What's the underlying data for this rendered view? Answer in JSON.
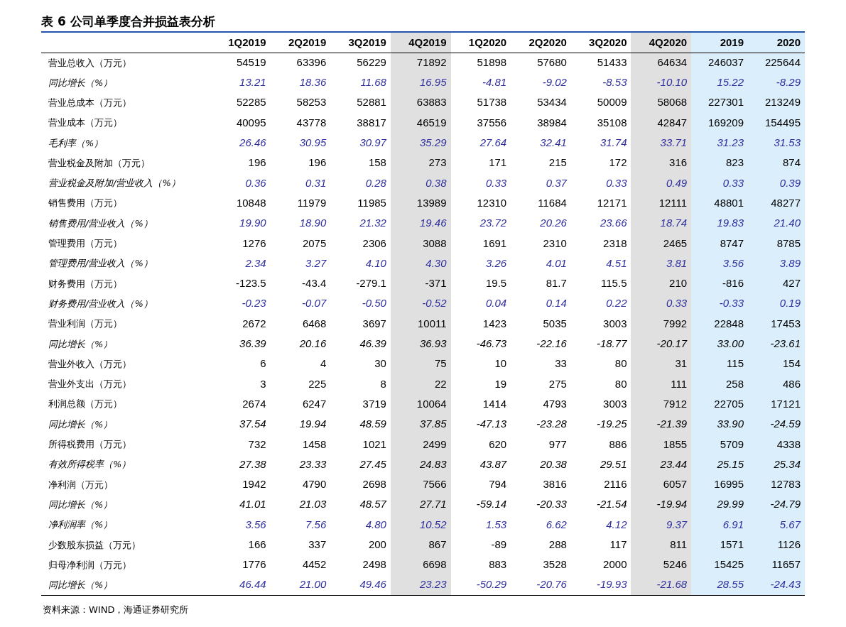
{
  "title": "表 6 公司单季度合并损益表分析",
  "columns": [
    {
      "label": "1Q2019"
    },
    {
      "label": "2Q2019"
    },
    {
      "label": "3Q2019"
    },
    {
      "label": "4Q2019",
      "color": "#e0e0e0"
    },
    {
      "label": "1Q2020"
    },
    {
      "label": "2Q2020"
    },
    {
      "label": "3Q2020"
    },
    {
      "label": "4Q2020",
      "color": "#e0e0e0"
    },
    {
      "label": "2019",
      "color": "#daeefb"
    },
    {
      "label": "2020",
      "color": "#daeefb"
    }
  ],
  "rows": [
    {
      "label": "营业总收入（万元）",
      "kind": "amount",
      "values": [
        "54519",
        "63396",
        "56229",
        "71892",
        "51898",
        "57680",
        "51433",
        "64634",
        "246037",
        "225644"
      ]
    },
    {
      "label": "同比增长（%）",
      "kind": "ratio",
      "values": [
        "13.21",
        "18.36",
        "11.68",
        "16.95",
        "-4.81",
        "-9.02",
        "-8.53",
        "-10.10",
        "15.22",
        "-8.29"
      ]
    },
    {
      "label": "营业总成本（万元）",
      "kind": "amount",
      "values": [
        "52285",
        "58253",
        "52881",
        "63883",
        "51738",
        "53434",
        "50009",
        "58068",
        "227301",
        "213249"
      ]
    },
    {
      "label": "营业成本（万元）",
      "kind": "amount",
      "values": [
        "40095",
        "43778",
        "38817",
        "46519",
        "37556",
        "38984",
        "35108",
        "42847",
        "169209",
        "154495"
      ]
    },
    {
      "label": "毛利率（%）",
      "kind": "ratio",
      "values": [
        "26.46",
        "30.95",
        "30.97",
        "35.29",
        "27.64",
        "32.41",
        "31.74",
        "33.71",
        "31.23",
        "31.53"
      ]
    },
    {
      "label": "营业税金及附加（万元）",
      "kind": "amount",
      "values": [
        "196",
        "196",
        "158",
        "273",
        "171",
        "215",
        "172",
        "316",
        "823",
        "874"
      ]
    },
    {
      "label": "营业税金及附加/营业收入（%）",
      "kind": "ratio",
      "values": [
        "0.36",
        "0.31",
        "0.28",
        "0.38",
        "0.33",
        "0.37",
        "0.33",
        "0.49",
        "0.33",
        "0.39"
      ]
    },
    {
      "label": "销售费用（万元）",
      "kind": "amount",
      "values": [
        "10848",
        "11979",
        "11985",
        "13989",
        "12310",
        "11684",
        "12171",
        "12111",
        "48801",
        "48277"
      ]
    },
    {
      "label": "销售费用/营业收入（%）",
      "kind": "ratio",
      "values": [
        "19.90",
        "18.90",
        "21.32",
        "19.46",
        "23.72",
        "20.26",
        "23.66",
        "18.74",
        "19.83",
        "21.40"
      ]
    },
    {
      "label": "管理费用（万元）",
      "kind": "amount",
      "values": [
        "1276",
        "2075",
        "2306",
        "3088",
        "1691",
        "2310",
        "2318",
        "2465",
        "8747",
        "8785"
      ]
    },
    {
      "label": "管理费用/营业收入（%）",
      "kind": "ratio",
      "values": [
        "2.34",
        "3.27",
        "4.10",
        "4.30",
        "3.26",
        "4.01",
        "4.51",
        "3.81",
        "3.56",
        "3.89"
      ]
    },
    {
      "label": "财务费用（万元）",
      "kind": "amount",
      "values": [
        "-123.5",
        "-43.4",
        "-279.1",
        "-371",
        "19.5",
        "81.7",
        "115.5",
        "210",
        "-816",
        "427"
      ]
    },
    {
      "label": "财务费用/营业收入（%）",
      "kind": "ratio",
      "values": [
        "-0.23",
        "-0.07",
        "-0.50",
        "-0.52",
        "0.04",
        "0.14",
        "0.22",
        "0.33",
        "-0.33",
        "0.19"
      ]
    },
    {
      "label": "营业利润（万元）",
      "kind": "amount",
      "values": [
        "2672",
        "6468",
        "3697",
        "10011",
        "1423",
        "5035",
        "3003",
        "7992",
        "22848",
        "17453"
      ]
    },
    {
      "label": "同比增长（%）",
      "kind": "growth",
      "values": [
        "36.39",
        "20.16",
        "46.39",
        "36.93",
        "-46.73",
        "-22.16",
        "-18.77",
        "-20.17",
        "33.00",
        "-23.61"
      ]
    },
    {
      "label": "营业外收入（万元）",
      "kind": "amount",
      "values": [
        "6",
        "4",
        "30",
        "75",
        "10",
        "33",
        "80",
        "31",
        "115",
        "154"
      ]
    },
    {
      "label": "营业外支出（万元）",
      "kind": "amount",
      "values": [
        "3",
        "225",
        "8",
        "22",
        "19",
        "275",
        "80",
        "111",
        "258",
        "486"
      ]
    },
    {
      "label": "利润总额（万元）",
      "kind": "amount",
      "values": [
        "2674",
        "6247",
        "3719",
        "10064",
        "1414",
        "4793",
        "3003",
        "7912",
        "22705",
        "17121"
      ]
    },
    {
      "label": "同比增长（%）",
      "kind": "growth",
      "values": [
        "37.54",
        "19.94",
        "48.59",
        "37.85",
        "-47.13",
        "-23.28",
        "-19.25",
        "-21.39",
        "33.90",
        "-24.59"
      ]
    },
    {
      "label": "所得税费用（万元）",
      "kind": "amount",
      "values": [
        "732",
        "1458",
        "1021",
        "2499",
        "620",
        "977",
        "886",
        "1855",
        "5709",
        "4338"
      ]
    },
    {
      "label": "有效所得税率（%）",
      "kind": "growth",
      "values": [
        "27.38",
        "23.33",
        "27.45",
        "24.83",
        "43.87",
        "20.38",
        "29.51",
        "23.44",
        "25.15",
        "25.34"
      ]
    },
    {
      "label": "净利润（万元）",
      "kind": "amount",
      "values": [
        "1942",
        "4790",
        "2698",
        "7566",
        "794",
        "3816",
        "2116",
        "6057",
        "16995",
        "12783"
      ]
    },
    {
      "label": "同比增长（%）",
      "kind": "growth",
      "values": [
        "41.01",
        "21.03",
        "48.57",
        "27.71",
        "-59.14",
        "-20.33",
        "-21.54",
        "-19.94",
        "29.99",
        "-24.79"
      ]
    },
    {
      "label": "净利润率（%）",
      "kind": "ratio",
      "values": [
        "3.56",
        "7.56",
        "4.80",
        "10.52",
        "1.53",
        "6.62",
        "4.12",
        "9.37",
        "6.91",
        "5.67"
      ]
    },
    {
      "label": "少数股东损益（万元）",
      "kind": "amount",
      "values": [
        "166",
        "337",
        "200",
        "867",
        "-89",
        "288",
        "117",
        "811",
        "1571",
        "1126"
      ]
    },
    {
      "label": "归母净利润（万元）",
      "kind": "amount",
      "values": [
        "1776",
        "4452",
        "2498",
        "6698",
        "883",
        "3528",
        "2000",
        "5246",
        "15425",
        "11657"
      ]
    },
    {
      "label": "同比增长（%）",
      "kind": "ratio",
      "values": [
        "46.44",
        "21.00",
        "49.46",
        "23.23",
        "-50.29",
        "-20.76",
        "-19.93",
        "-21.68",
        "28.55",
        "-24.43"
      ]
    }
  ],
  "source": "资料来源：WIND，海通证券研究所"
}
